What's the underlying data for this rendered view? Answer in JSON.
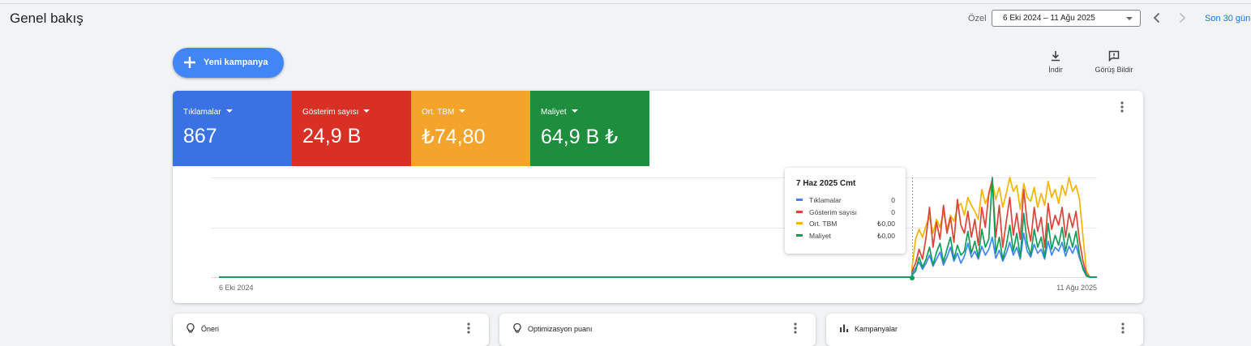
{
  "header": {
    "title": "Genel bakış",
    "date_label": "Özel",
    "date_range": "6 Eki 2024 – 11 Ağu 2025",
    "last_days_link": "Son 30 gün"
  },
  "toolbar": {
    "new_campaign_label": "Yeni kampanya",
    "download_label": "İndir",
    "feedback_label": "Görüş Bildir"
  },
  "metrics": [
    {
      "label": "Tıklamalar",
      "value": "867",
      "color": "#3a71e3"
    },
    {
      "label": "Gösterim sayısı",
      "value": "24,9 B",
      "color": "#d93025"
    },
    {
      "label": "Ort. TBM",
      "value": "₺74,80",
      "color": "#f4a42b"
    },
    {
      "label": "Maliyet",
      "value": "64,9 B ₺",
      "color": "#1e8e3e"
    }
  ],
  "chart_data": {
    "type": "line",
    "x_start_label": "6 Eki 2024",
    "x_end_label": "11 Ağu 2025",
    "grid": true,
    "series": [
      {
        "name": "Tıklamalar",
        "color": "#4285f4",
        "values": [
          4,
          9,
          15,
          8,
          14,
          22,
          11,
          18,
          25,
          12,
          20,
          30,
          16,
          24,
          14,
          21,
          34,
          20,
          26,
          18,
          31,
          22,
          28,
          40,
          19,
          27,
          16,
          24,
          35,
          22,
          30,
          18,
          44,
          26,
          20,
          33,
          24,
          28,
          18,
          36,
          22,
          30,
          26,
          35,
          21,
          31,
          24,
          32,
          19,
          10,
          2,
          0,
          0,
          0
        ]
      },
      {
        "name": "Gösterim sayısı",
        "color": "#db4437",
        "values": [
          6,
          14,
          28,
          18,
          40,
          70,
          30,
          55,
          38,
          72,
          44,
          60,
          35,
          78,
          52,
          44,
          66,
          40,
          58,
          32,
          70,
          50,
          84,
          98,
          40,
          72,
          30,
          56,
          80,
          42,
          64,
          38,
          88,
          54,
          36,
          70,
          46,
          60,
          30,
          74,
          48,
          62,
          52,
          70,
          40,
          64,
          50,
          66,
          36,
          16,
          3,
          0,
          0,
          0
        ]
      },
      {
        "name": "Ort. TBM",
        "color": "#f4b400",
        "values": [
          10,
          38,
          48,
          40,
          52,
          60,
          44,
          58,
          50,
          66,
          48,
          62,
          56,
          70,
          74,
          62,
          80,
          72,
          66,
          58,
          88,
          74,
          82,
          96,
          78,
          90,
          70,
          84,
          100,
          86,
          92,
          68,
          94,
          80,
          76,
          90,
          70,
          84,
          72,
          96,
          80,
          88,
          74,
          92,
          82,
          100,
          86,
          92,
          78,
          40,
          6,
          0,
          0,
          0
        ]
      },
      {
        "name": "Maliyet",
        "color": "#0f9d58",
        "values": [
          2,
          6,
          20,
          10,
          18,
          30,
          12,
          25,
          34,
          15,
          28,
          40,
          18,
          32,
          22,
          26,
          46,
          24,
          36,
          20,
          48,
          30,
          38,
          100,
          24,
          40,
          18,
          32,
          52,
          26,
          44,
          20,
          64,
          34,
          22,
          48,
          30,
          40,
          20,
          54,
          28,
          42,
          32,
          50,
          26,
          44,
          30,
          46,
          22,
          8,
          1,
          0,
          0,
          0
        ]
      }
    ]
  },
  "tooltip": {
    "date": "7 Haz 2025 Cmt",
    "rows": [
      {
        "name": "Tıklamalar",
        "value": "0",
        "color": "#4285f4"
      },
      {
        "name": "Gösterim sayısı",
        "value": "0",
        "color": "#db4437"
      },
      {
        "name": "Ort. TBM",
        "value": "₺0,00",
        "color": "#f4b400"
      },
      {
        "name": "Maliyet",
        "value": "₺0,00",
        "color": "#0f9d58"
      }
    ]
  },
  "cards": [
    {
      "title": "Öneri",
      "icon": "lightbulb-icon"
    },
    {
      "title": "Optimizasyon puanı",
      "icon": "lightbulb-icon"
    },
    {
      "title": "Kampanyalar",
      "icon": "bar-chart-icon"
    }
  ]
}
